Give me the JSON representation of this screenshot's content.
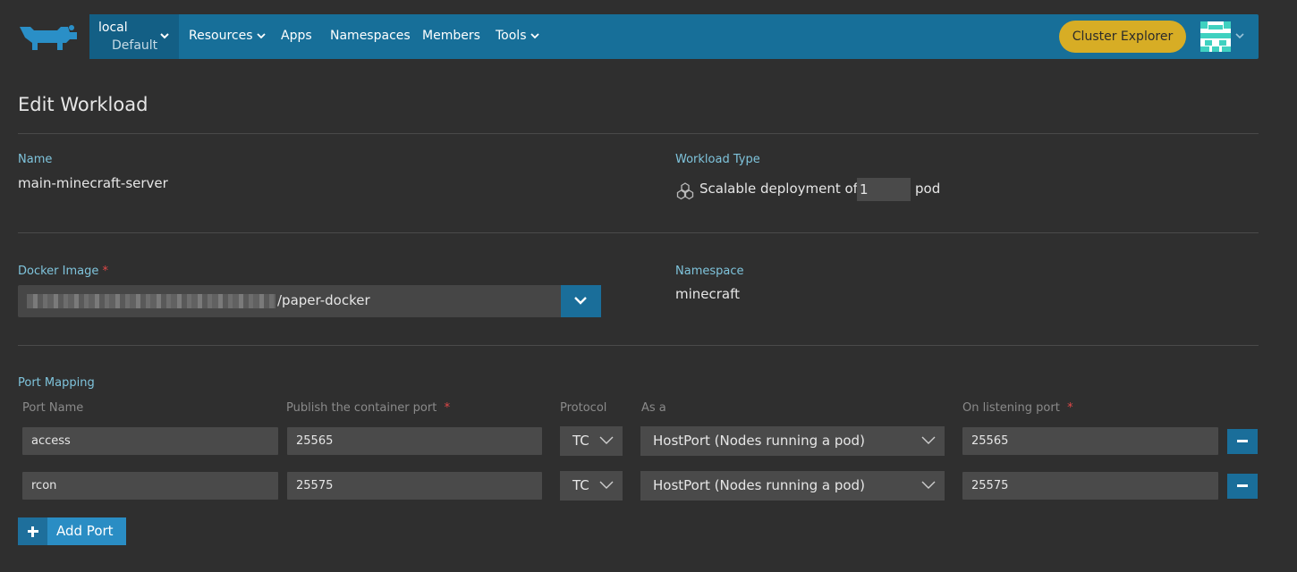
{
  "nav": {
    "cluster": "local",
    "project": "Default",
    "items": [
      {
        "label": "Resources",
        "dropdown": true
      },
      {
        "label": "Apps",
        "dropdown": false
      },
      {
        "label": "Namespaces",
        "dropdown": false
      },
      {
        "label": "Members",
        "dropdown": false
      },
      {
        "label": "Tools",
        "dropdown": true
      }
    ],
    "cluster_explorer": "Cluster Explorer"
  },
  "page": {
    "title": "Edit Workload"
  },
  "name": {
    "label": "Name",
    "value": "main-minecraft-server"
  },
  "workload_type": {
    "label": "Workload Type",
    "text_before": "Scalable deployment of",
    "pods": "1",
    "text_after": "pod"
  },
  "docker_image": {
    "label": "Docker Image",
    "required": "*",
    "value_visible": "/paper-docker"
  },
  "namespace": {
    "label": "Namespace",
    "value": "minecraft"
  },
  "port_mapping": {
    "label": "Port Mapping",
    "headers": {
      "port_name": "Port Name",
      "publish": "Publish the container port",
      "protocol": "Protocol",
      "as_a": "As a",
      "listening": "On listening port"
    },
    "required": "*",
    "rows": [
      {
        "name": "access",
        "container_port": "25565",
        "protocol": "TC",
        "as": "HostPort (Nodes running a pod)",
        "listening_port": "25565"
      },
      {
        "name": "rcon",
        "container_port": "25575",
        "protocol": "TC",
        "as": "HostPort (Nodes running a pod)",
        "listening_port": "25575"
      }
    ],
    "add_label": "Add Port"
  },
  "colors": {
    "topnav": "#176f99",
    "accent_label": "#7fc4dc",
    "explorer": "#d7ad25",
    "button": "#1a6e9a"
  }
}
